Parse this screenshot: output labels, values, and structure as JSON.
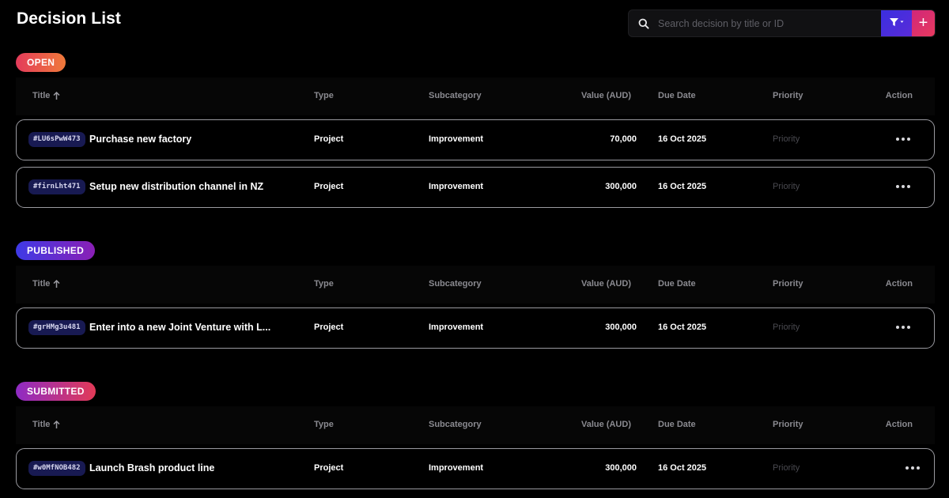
{
  "page": {
    "title": "Decision List"
  },
  "search": {
    "placeholder": "Search decision by title or ID"
  },
  "toolbar": {
    "filter_icon": "filter-icon",
    "add_label": "+"
  },
  "columns": {
    "title": "Title",
    "type": "Type",
    "subcategory": "Subcategory",
    "value": "Value (AUD)",
    "due_date": "Due Date",
    "priority": "Priority",
    "action": "Action"
  },
  "colors": {
    "open": [
      "#e33b5b",
      "#f07a3a"
    ],
    "published": [
      "#3e3ae6",
      "#8a1fb5"
    ],
    "submitted": [
      "#8e2bc4",
      "#e23a57"
    ],
    "filter_button": "#4a2de0",
    "add_button": "#e0306a"
  },
  "sections": [
    {
      "status": "OPEN",
      "rows": [
        {
          "id": "#LU6sPwW473",
          "title": "Purchase new factory",
          "type": "Project",
          "subcategory": "Improvement",
          "value": "70,000",
          "due_date": "16 Oct 2025",
          "priority": "Priority"
        },
        {
          "id": "#firnLht471",
          "title": "Setup new distribution channel in NZ",
          "type": "Project",
          "subcategory": "Improvement",
          "value": "300,000",
          "due_date": "16 Oct 2025",
          "priority": "Priority"
        }
      ]
    },
    {
      "status": "PUBLISHED",
      "rows": [
        {
          "id": "#grHMg3u481",
          "title": "Enter into a new Joint Venture with L...",
          "type": "Project",
          "subcategory": "Improvement",
          "value": "300,000",
          "due_date": "16 Oct 2025",
          "priority": "Priority"
        }
      ]
    },
    {
      "status": "SUBMITTED",
      "rows": [
        {
          "id": "#w0MfNOB482",
          "title": "Launch Brash product line",
          "type": "Project",
          "subcategory": "Improvement",
          "value": "300,000",
          "due_date": "16 Oct 2025",
          "priority": "Priority"
        }
      ]
    }
  ]
}
